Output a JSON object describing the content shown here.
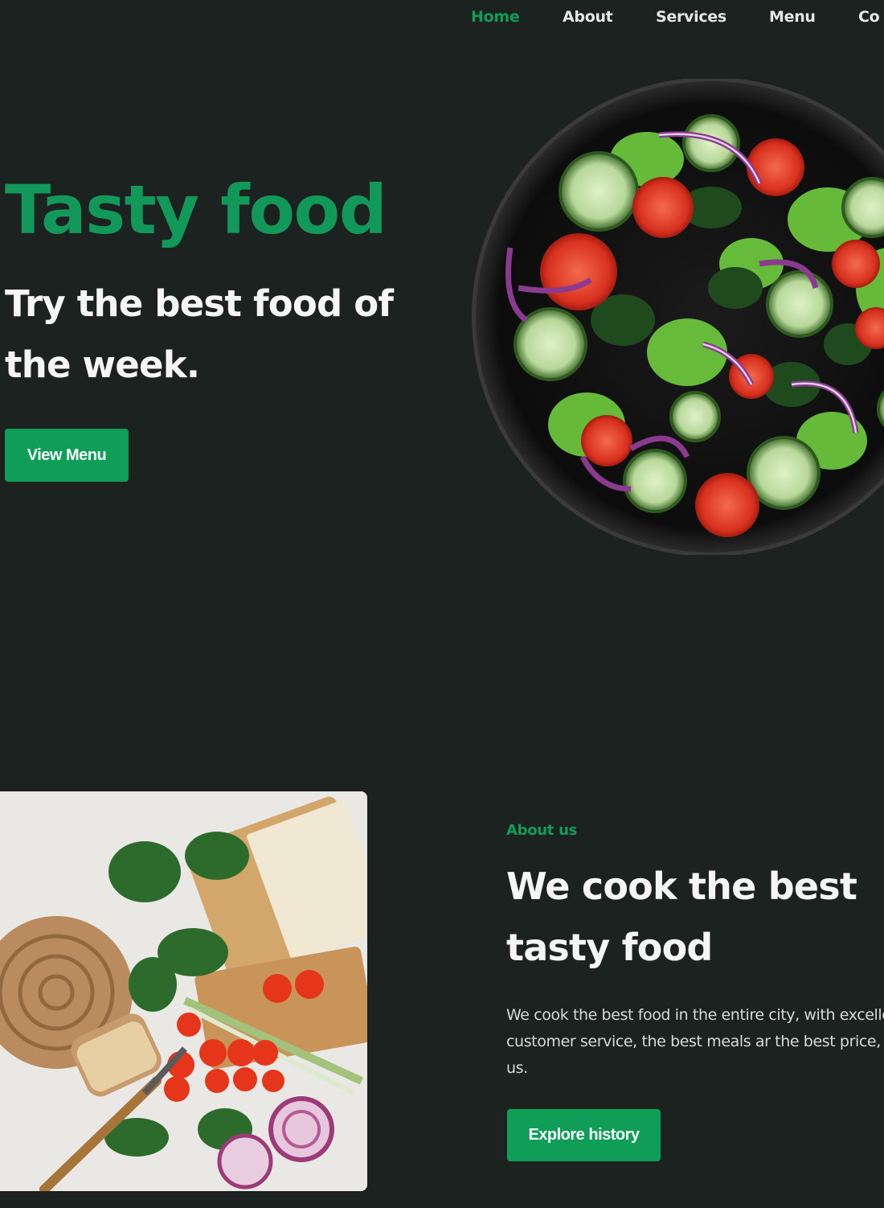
{
  "nav": {
    "items": [
      {
        "label": "Home",
        "active": true
      },
      {
        "label": "About",
        "active": false
      },
      {
        "label": "Services",
        "active": false
      },
      {
        "label": "Menu",
        "active": false
      },
      {
        "label": "Co",
        "active": false
      }
    ]
  },
  "hero": {
    "title": "Tasty food",
    "subtitle": "Try the best food of the week.",
    "button_label": "View Menu"
  },
  "about": {
    "eyebrow": "About us",
    "title": "We cook the best tasty food",
    "description": "We cook the best food in the entire city, with excellent customer service, the best meals ar the best price, visit us.",
    "button_label": "Explore history"
  },
  "colors": {
    "background": "#1c2220",
    "accent": "#0f9d58",
    "text": "#f5f5f5"
  }
}
